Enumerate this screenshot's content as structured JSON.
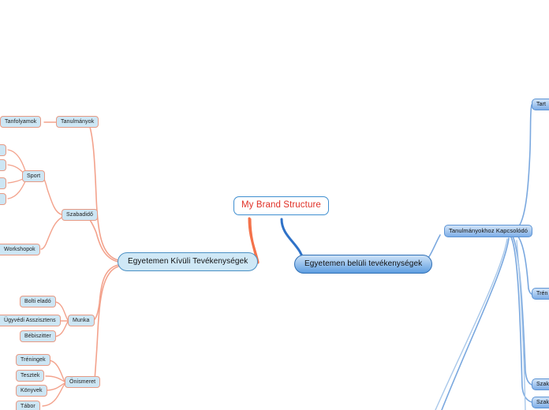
{
  "app": {
    "type": "mind-map",
    "background": "#ffffff",
    "colors": {
      "root_text": "#e03127",
      "root_border": "#3f8fd0",
      "left_branch_edge": "#f4724a",
      "left_sub_edge": "#f3a28c",
      "right_branch_edge": "#2f72c8",
      "right_sub_edge": "#7aa8df",
      "node_fill_light": "#cde6f4",
      "node_fill_blue": "#9cc4ee",
      "node_border_light": "#7ba7c9",
      "node_border_blue": "#5d94d4"
    }
  },
  "root": {
    "label": "My Brand Structure"
  },
  "branches": {
    "left": {
      "label": "Egyetemen Kívüli Tevékenységek",
      "children": [
        {
          "label": "Tanulmányok",
          "children": [
            {
              "label": "Tanfolyamok"
            }
          ]
        },
        {
          "label": "Szabadidő",
          "children": [
            {
              "label": "Sport"
            },
            {
              "label": "Workshopok"
            }
          ]
        },
        {
          "label": "Munka",
          "children": [
            {
              "label": "Bolti eladó"
            },
            {
              "label": "Ügyvédi Asszisztens"
            },
            {
              "label": "Bébiszitter"
            }
          ]
        },
        {
          "label": "Önismeret",
          "children": [
            {
              "label": "Tréningek"
            },
            {
              "label": "Tesztek"
            },
            {
              "label": "Könyvek"
            },
            {
              "label": "Tábor"
            }
          ]
        }
      ]
    },
    "right": {
      "label": "Egyetemen belüli tevékenységek",
      "children": [
        {
          "label": "Tanulmányokhoz Kapcsolódó",
          "children": [
            {
              "label": "Tart",
              "clipped": true
            },
            {
              "label": "Trén",
              "clipped": true
            },
            {
              "label": "Szak",
              "clipped": true
            },
            {
              "label": "Szak",
              "clipped": true
            }
          ]
        }
      ]
    }
  },
  "clipped_nodes": {
    "sport_inputs": [
      "",
      "",
      "",
      ""
    ],
    "note": "four nodes clipped by the left viewport edge feeding Sport"
  }
}
